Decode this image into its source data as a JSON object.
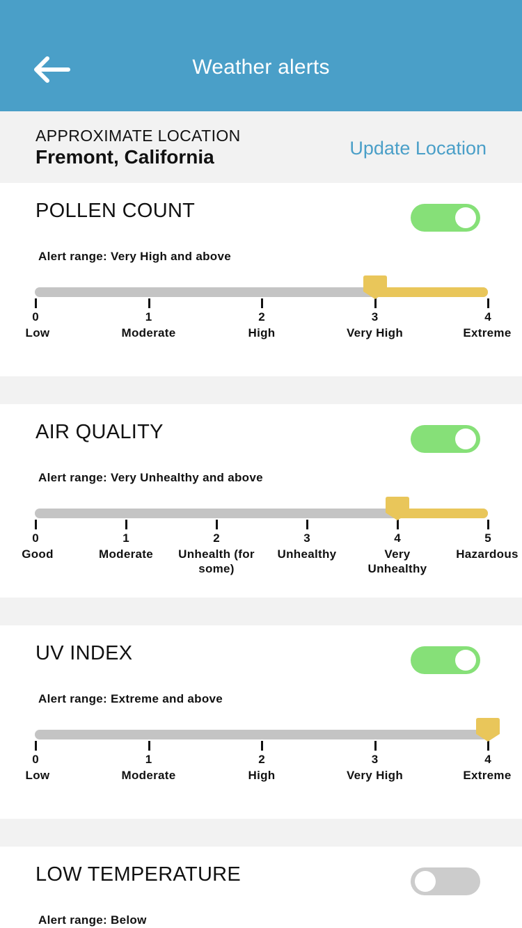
{
  "header": {
    "title": "Weather alerts",
    "back_icon": "arrow-left-icon"
  },
  "location": {
    "caption": "APPROXIMATE LOCATION",
    "city": "Fremont, California",
    "update_label": "Update Location"
  },
  "colors": {
    "header_bg": "#4a9fc8",
    "accent_blue": "#4a9fc8",
    "toggle_on": "#86e078",
    "toggle_off": "#cccccc",
    "slider_active": "#e9c65a",
    "track": "#c4c4c4",
    "page_bg": "#f2f2f2"
  },
  "alerts": [
    {
      "title": "POLLEN COUNT",
      "enabled": true,
      "range_text": "Alert range: Very High and above",
      "selected": 3,
      "ticks": [
        {
          "num": "0",
          "label": "Low"
        },
        {
          "num": "1",
          "label": "Moderate"
        },
        {
          "num": "2",
          "label": "High"
        },
        {
          "num": "3",
          "label": "Very High"
        },
        {
          "num": "4",
          "label": "Extreme"
        }
      ]
    },
    {
      "title": "AIR QUALITY",
      "enabled": true,
      "range_text": "Alert range: Very Unhealthy and above",
      "selected": 4,
      "ticks": [
        {
          "num": "0",
          "label": "Good"
        },
        {
          "num": "1",
          "label": "Moderate"
        },
        {
          "num": "2",
          "label": "Unhealth (for some)"
        },
        {
          "num": "3",
          "label": "Unhealthy"
        },
        {
          "num": "4",
          "label": "Very Unhealthy"
        },
        {
          "num": "5",
          "label": "Hazardous"
        }
      ]
    },
    {
      "title": "UV INDEX",
      "enabled": true,
      "range_text": "Alert range: Extreme and above",
      "selected": 4,
      "ticks": [
        {
          "num": "0",
          "label": "Low"
        },
        {
          "num": "1",
          "label": "Moderate"
        },
        {
          "num": "2",
          "label": "High"
        },
        {
          "num": "3",
          "label": "Very High"
        },
        {
          "num": "4",
          "label": "Extreme"
        }
      ]
    },
    {
      "title": "LOW TEMPERATURE",
      "enabled": false,
      "range_text": "Alert range: Below",
      "selected": null,
      "ticks": []
    }
  ]
}
